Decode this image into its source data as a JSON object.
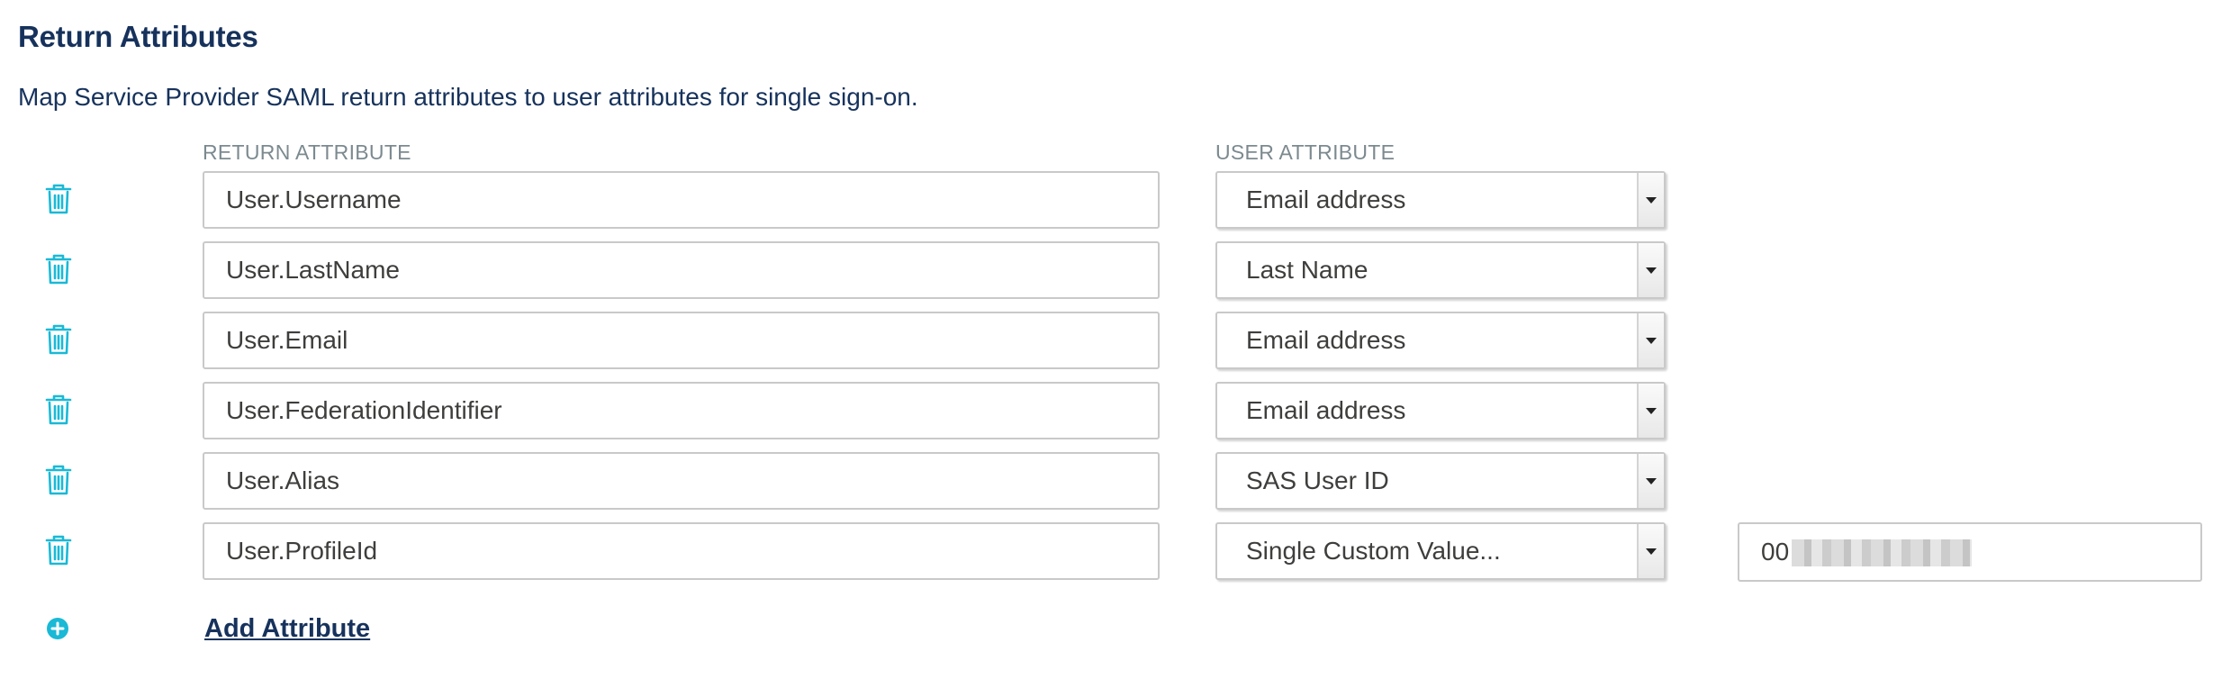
{
  "section": {
    "title": "Return Attributes",
    "description": "Map Service Provider SAML return attributes to user attributes for single sign-on."
  },
  "columns": {
    "return_attribute": "RETURN ATTRIBUTE",
    "user_attribute": "USER ATTRIBUTE"
  },
  "rows": [
    {
      "return_attribute": "User.Username",
      "user_attribute": "Email address"
    },
    {
      "return_attribute": "User.LastName",
      "user_attribute": "Last Name"
    },
    {
      "return_attribute": "User.Email",
      "user_attribute": "Email address"
    },
    {
      "return_attribute": "User.FederationIdentifier",
      "user_attribute": "Email address"
    },
    {
      "return_attribute": "User.Alias",
      "user_attribute": "SAS User ID"
    },
    {
      "return_attribute": "User.ProfileId",
      "user_attribute": "Single Custom Value...",
      "custom_value": "00"
    }
  ],
  "add_attribute_label": "Add Attribute",
  "icons": {
    "delete": "trash-icon",
    "add": "plus-circle-icon",
    "dropdown": "chevron-down-icon"
  },
  "colors": {
    "heading": "#16325c",
    "icon_accent": "#1ab9d6",
    "column_header": "#7c8a90",
    "input_border": "#c9c9c9"
  }
}
